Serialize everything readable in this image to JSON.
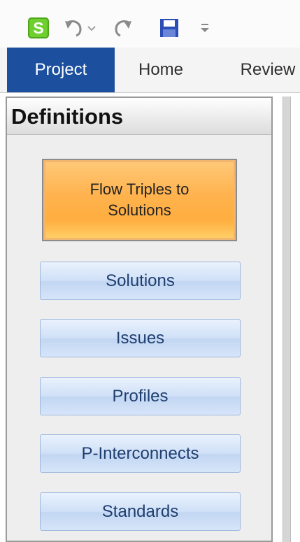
{
  "qat": {
    "app_icon_letter": "S",
    "icons": [
      "undo-icon",
      "redo-icon",
      "save-icon",
      "customize-icon"
    ]
  },
  "tabs": [
    {
      "label": "Project",
      "active": true
    },
    {
      "label": "Home",
      "active": false
    },
    {
      "label": "Review",
      "active": false
    }
  ],
  "pane": {
    "title": "Definitions",
    "featured_button": "Flow Triples to Solutions",
    "buttons": [
      "Solutions",
      "Issues",
      "Profiles",
      "P-Interconnects",
      "Standards"
    ]
  },
  "colors": {
    "active_tab": "#1d4f9f",
    "featured_orange": "#ffb24d",
    "button_blue": "#cfe0f7"
  }
}
